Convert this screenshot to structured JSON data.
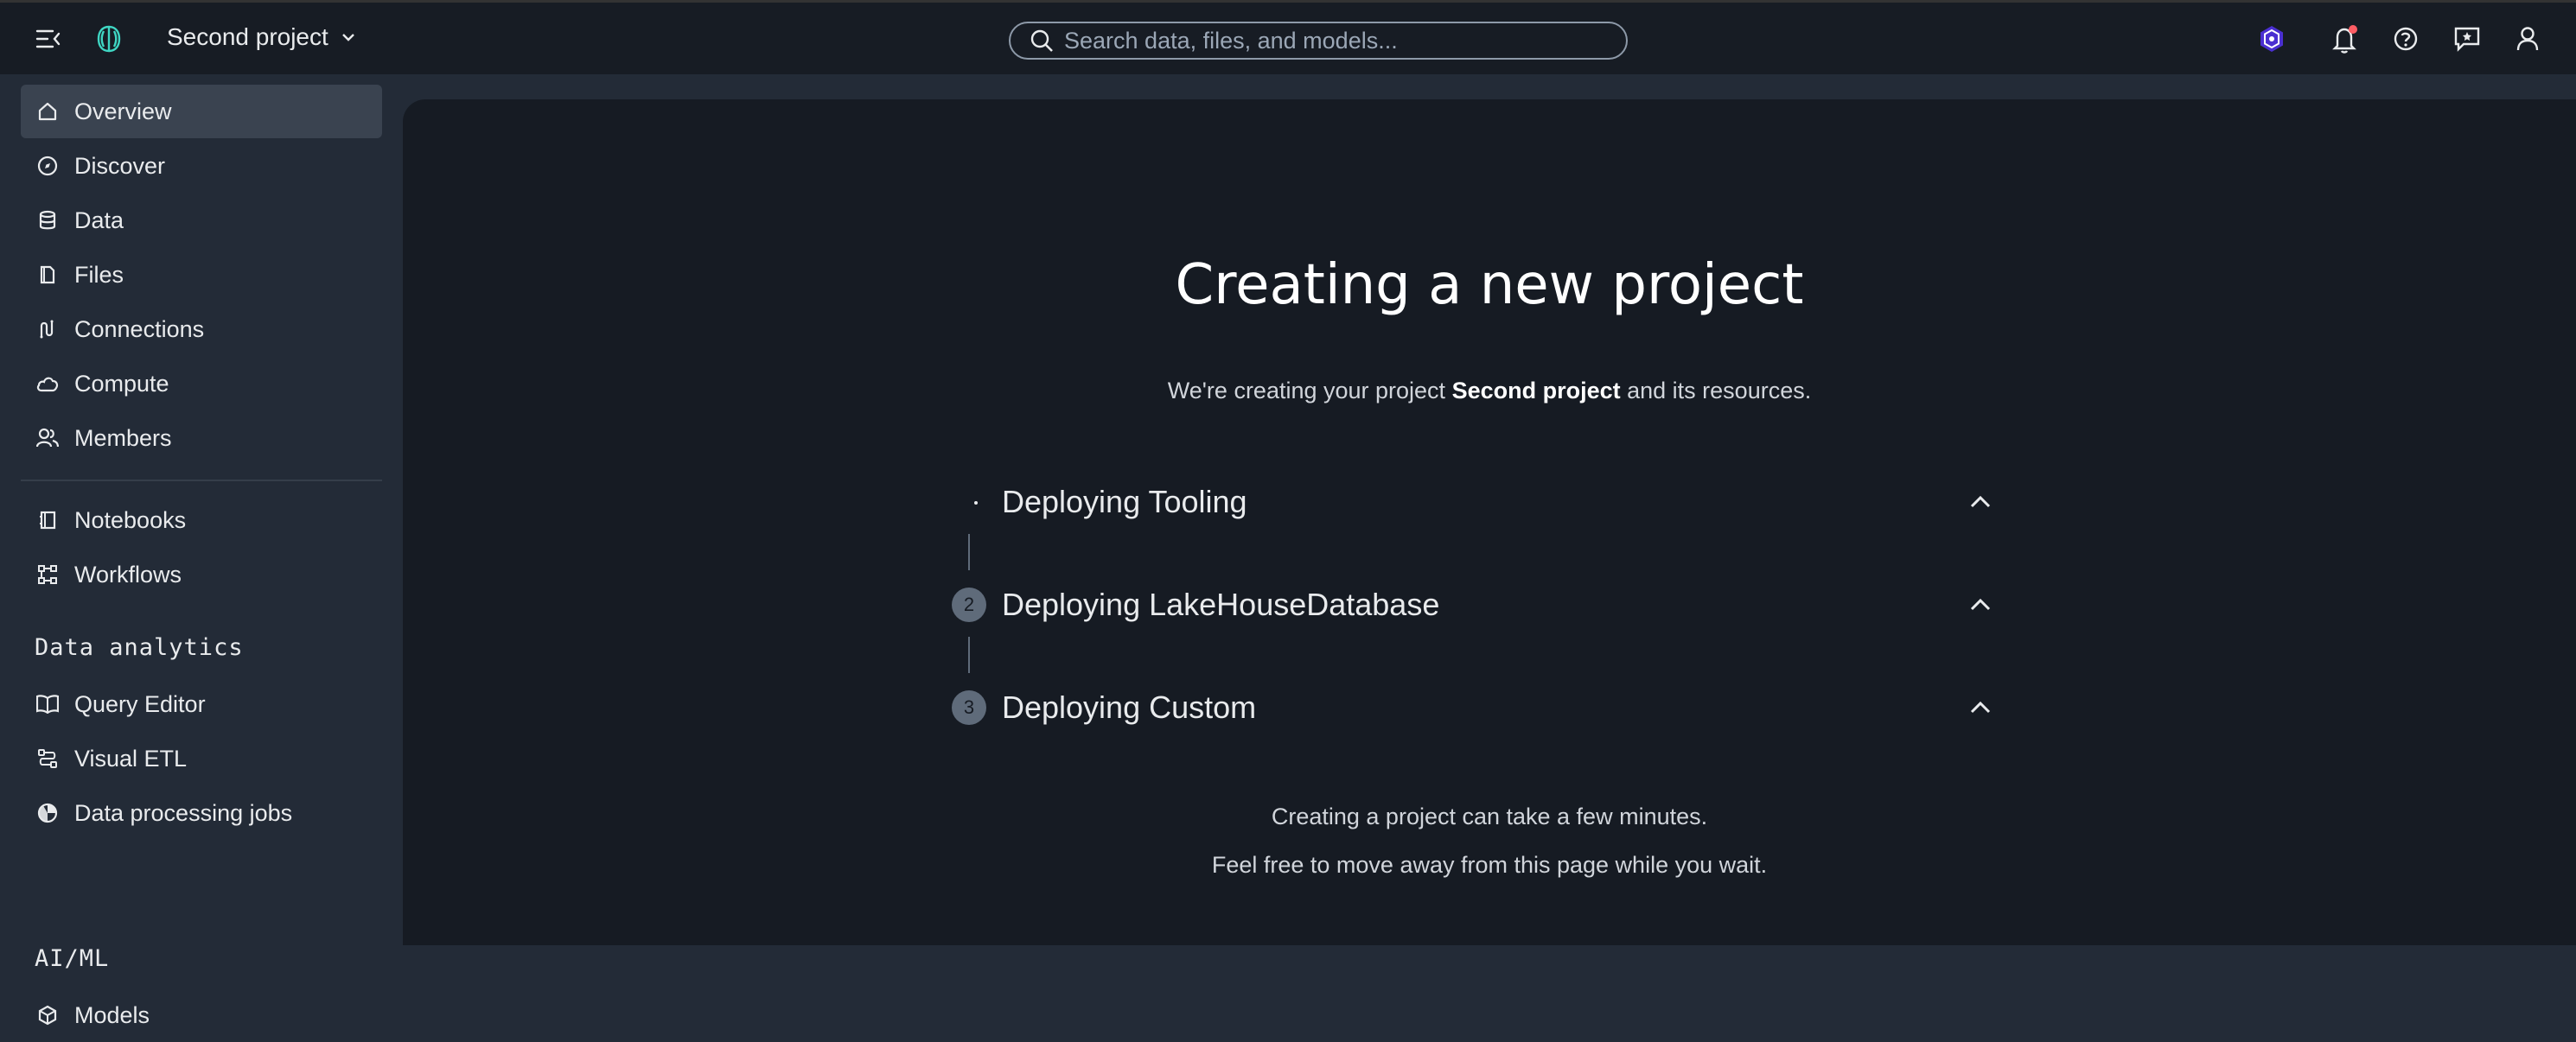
{
  "header": {
    "project_name": "Second project",
    "search_placeholder": "Search data, files, and models..."
  },
  "sidebar": {
    "items": [
      {
        "label": "Overview",
        "icon": "home-icon",
        "active": true
      },
      {
        "label": "Discover",
        "icon": "compass-icon"
      },
      {
        "label": "Data",
        "icon": "database-icon"
      },
      {
        "label": "Files",
        "icon": "file-icon"
      },
      {
        "label": "Connections",
        "icon": "connections-icon"
      },
      {
        "label": "Compute",
        "icon": "cloud-icon"
      },
      {
        "label": "Members",
        "icon": "users-icon"
      }
    ],
    "items2": [
      {
        "label": "Notebooks",
        "icon": "notebook-icon"
      },
      {
        "label": "Workflows",
        "icon": "workflow-icon"
      }
    ],
    "section_data_analytics": "Data analytics",
    "analytics_items": [
      {
        "label": "Query Editor",
        "icon": "book-icon"
      },
      {
        "label": "Visual ETL",
        "icon": "etl-icon"
      },
      {
        "label": "Data processing jobs",
        "icon": "pie-icon"
      }
    ],
    "section_aiml": "AI/ML",
    "aiml_items": [
      {
        "label": "Models",
        "icon": "cube-icon"
      }
    ]
  },
  "main": {
    "title": "Creating a new project",
    "subtitle_prefix": "We're creating your project ",
    "subtitle_project": "Second project",
    "subtitle_suffix": " and its resources.",
    "steps": [
      {
        "number": "",
        "label": "Deploying Tooling"
      },
      {
        "number": "2",
        "label": "Deploying LakeHouseDatabase"
      },
      {
        "number": "3",
        "label": "Deploying Custom"
      }
    ],
    "footer_line1": "Creating a project can take a few minutes.",
    "footer_line2": "Feel free to move away from this page while you wait."
  },
  "colors": {
    "background": "#161b23",
    "sidebar": "#232b37",
    "topbar": "#171c24",
    "notification_dot": "#ff5d64",
    "badge_accent": "#7d5cff"
  }
}
